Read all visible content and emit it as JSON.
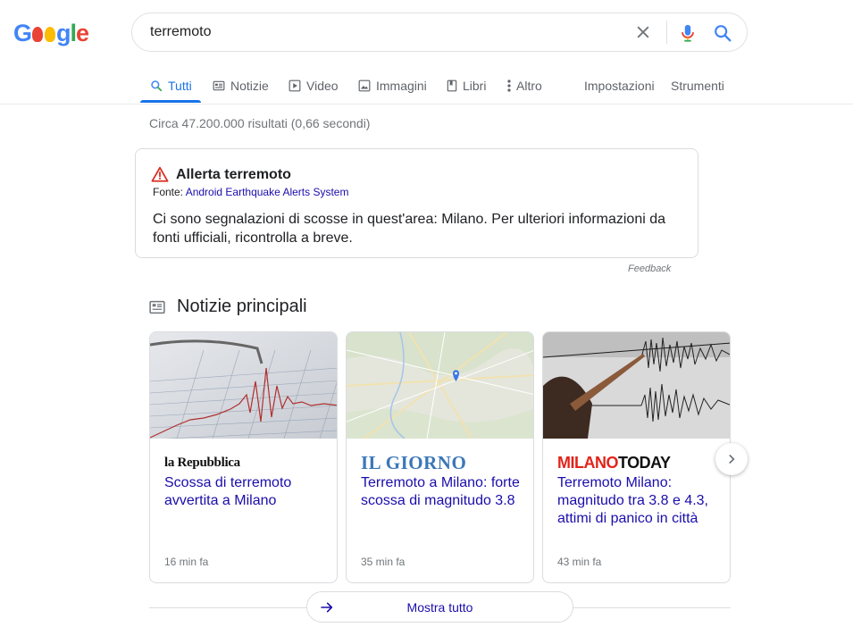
{
  "logo": {
    "letters": [
      "G",
      "g",
      "l",
      "e"
    ]
  },
  "search": {
    "query": "terremoto"
  },
  "tabs": [
    {
      "label": "Tutti",
      "icon": "search-icon"
    },
    {
      "label": "Notizie",
      "icon": "news-icon"
    },
    {
      "label": "Video",
      "icon": "play-icon"
    },
    {
      "label": "Immagini",
      "icon": "image-icon"
    },
    {
      "label": "Libri",
      "icon": "book-icon"
    },
    {
      "label": "Altro",
      "icon": "more-vert-icon"
    }
  ],
  "tools": {
    "settings": "Impostazioni",
    "tools": "Strumenti"
  },
  "stats": "Circa 47.200.000 risultati (0,66 secondi)",
  "alert": {
    "title": "Allerta terremoto",
    "source_prefix": "Fonte:",
    "source_link": "Android Earthquake Alerts System",
    "body": "Ci sono segnalazioni di scosse in quest'area: Milano. Per ulteriori informazioni da fonti ufficiali, ricontrolla a breve."
  },
  "feedback": "Feedback",
  "top_stories": {
    "title": "Notizie principali",
    "cards": [
      {
        "publisher": "la Repubblica",
        "headline": "Scossa di terremoto avvertita a Milano",
        "time": "16 min fa"
      },
      {
        "publisher": "IL GIORNO",
        "headline": "Terremoto a Milano: forte scossa di magnitudo 3.8",
        "time": "35 min fa"
      },
      {
        "publisher_red": "MILANO",
        "publisher_black": "TODAY",
        "headline": "Terremoto Milano: magnitudo tra 3.8 e 4.3, attimi di panico in città",
        "time": "43 min fa"
      }
    ],
    "show_all": "Mostra tutto"
  },
  "colors": {
    "accent": "#1a73e8",
    "link": "#1a0dab",
    "alert_red": "#d93025"
  }
}
